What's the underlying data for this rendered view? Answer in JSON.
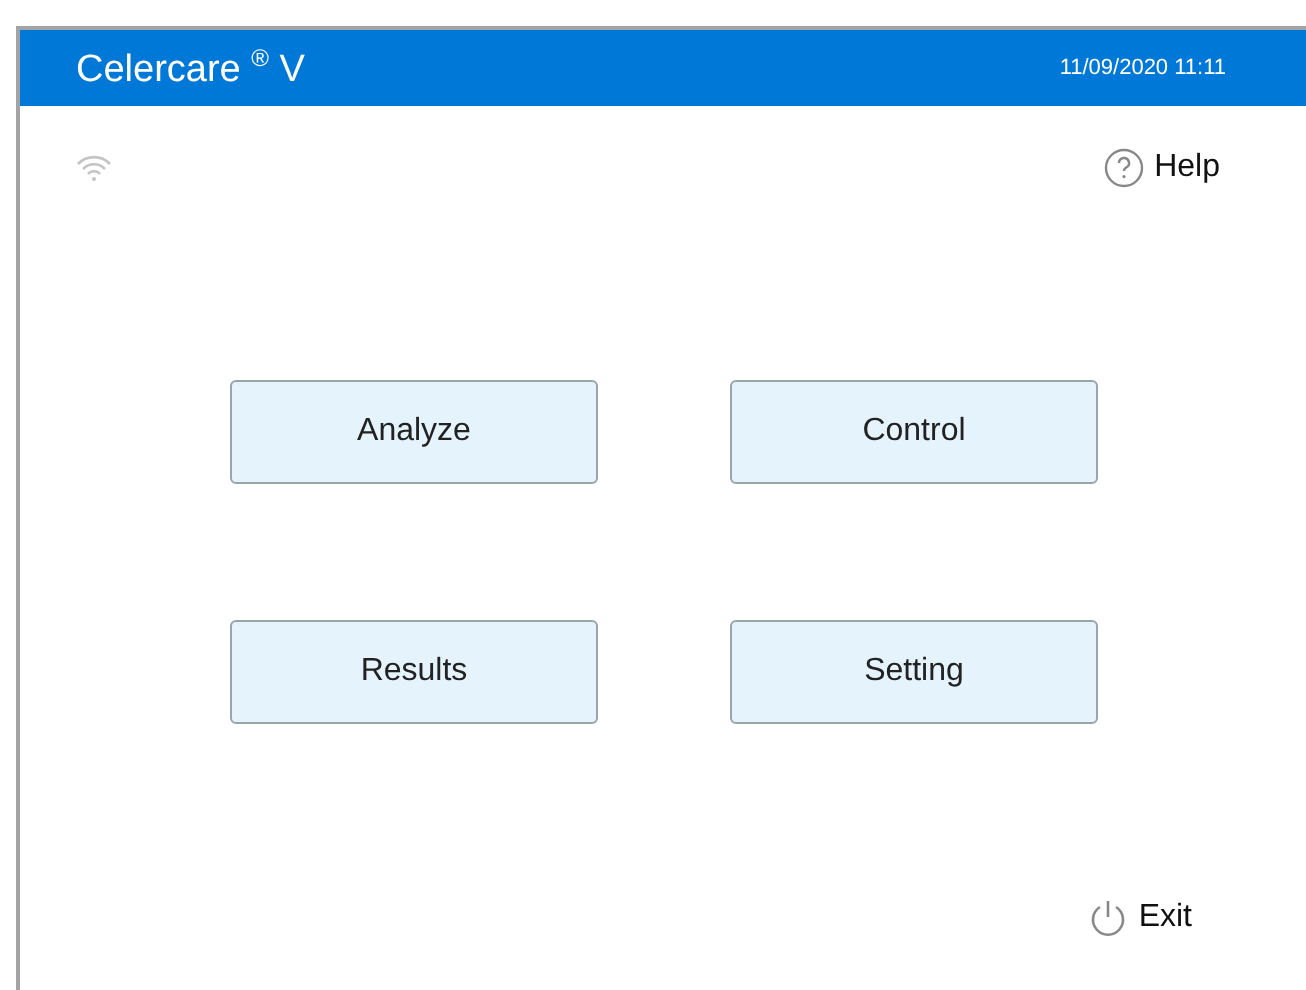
{
  "header": {
    "title": "Celercare $^{®}$ V",
    "datetime": "11/09/2020 11:11"
  },
  "help": {
    "label": "Help"
  },
  "menu_buttons": [
    {
      "label": "Analyze"
    },
    {
      "label": "Control"
    },
    {
      "label": "Results"
    },
    {
      "label": "Setting"
    }
  ],
  "exit": {
    "label": "Exit"
  }
}
